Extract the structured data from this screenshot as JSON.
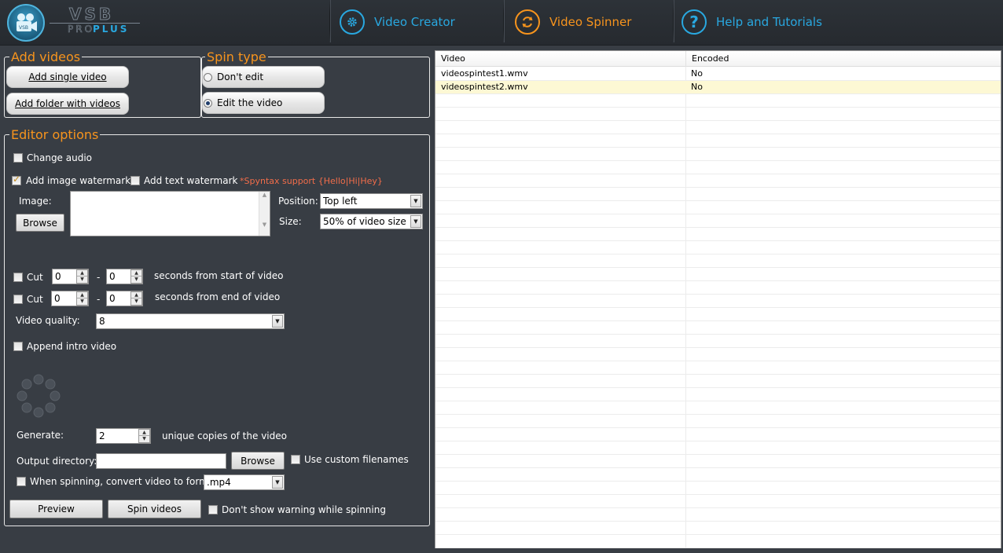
{
  "header": {
    "nav": [
      {
        "label": "Video Creator",
        "icon": "gear-icon",
        "color": "#29a8e0"
      },
      {
        "label": "Video Spinner",
        "icon": "refresh-icon",
        "color": "#f7941d"
      },
      {
        "label": "Help and Tutorials",
        "icon": "question-icon",
        "color": "#29a8e0"
      }
    ],
    "logo": {
      "main": "VSB",
      "sub1": "PRO",
      "sub2": "PLUS"
    }
  },
  "add_videos": {
    "legend": "Add videos",
    "single_btn": "Add single video",
    "folder_btn": "Add folder with videos"
  },
  "spin_type": {
    "legend": "Spin type",
    "options": [
      {
        "label": "Don't edit",
        "selected": false
      },
      {
        "label": "Edit the video",
        "selected": true
      }
    ]
  },
  "editor": {
    "legend": "Editor options",
    "change_audio": "Change audio",
    "add_image_watermark": "Add image watermark",
    "add_text_watermark": "Add text watermark",
    "syntax_note": "*Spyntax support {Hello|Hi|Hey}",
    "image_label": "Image:",
    "browse": "Browse",
    "position_label": "Position:",
    "position_value": "Top left",
    "size_label": "Size:",
    "size_value": "50% of video size",
    "cut_label": "Cut",
    "cut_start_from": "0",
    "cut_start_to": "0",
    "cut_start_text": "seconds from start of video",
    "cut_end_from": "0",
    "cut_end_to": "0",
    "cut_end_text": "seconds from end of video",
    "dash": "-",
    "quality_label": "Video quality:",
    "quality_value": "8",
    "append_intro": "Append intro video",
    "generate_label": "Generate:",
    "generate_value": "2",
    "generate_text": "unique copies of the video",
    "output_label": "Output directory:",
    "output_value": "",
    "output_browse": "Browse",
    "custom_filenames": "Use custom filenames",
    "convert_label": "When spinning, convert video to format:",
    "convert_value": ".mp4",
    "preview_btn": "Preview",
    "spin_btn": "Spin videos",
    "no_warning": "Don't show warning while spinning"
  },
  "table": {
    "columns": [
      "Video",
      "Encoded"
    ],
    "rows": [
      [
        "videospintest1.wmv",
        "No"
      ],
      [
        "videospintest2.wmv",
        "No"
      ]
    ],
    "selected_row": 1
  }
}
